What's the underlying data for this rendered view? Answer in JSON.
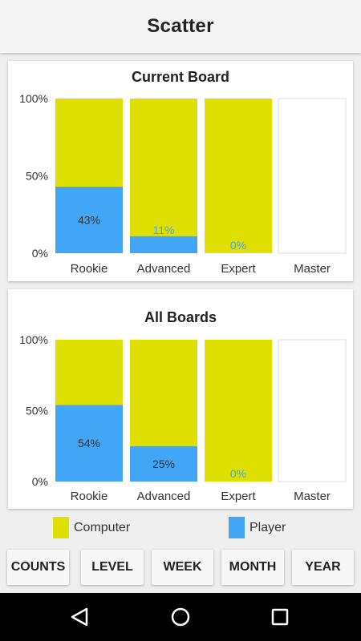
{
  "app": {
    "title": "Scatter"
  },
  "colors": {
    "computer": "#dfe000",
    "player": "#42a5f5",
    "empty": "#ffffff"
  },
  "chart_data": [
    {
      "type": "bar",
      "stacked": true,
      "title": "Current Board",
      "categories": [
        "Rookie",
        "Advanced",
        "Expert",
        "Master"
      ],
      "yticks": [
        "100%",
        "50%",
        "0%"
      ],
      "ylim": [
        0,
        100
      ],
      "series": [
        {
          "name": "Player",
          "values": [
            43,
            11,
            0,
            null
          ]
        },
        {
          "name": "Computer",
          "values": [
            57,
            89,
            100,
            null
          ]
        }
      ],
      "data_labels": [
        "43%",
        "11%",
        "0%",
        ""
      ]
    },
    {
      "type": "bar",
      "stacked": true,
      "title": "All Boards",
      "categories": [
        "Rookie",
        "Advanced",
        "Expert",
        "Master"
      ],
      "yticks": [
        "100%",
        "50%",
        "0%"
      ],
      "ylim": [
        0,
        100
      ],
      "series": [
        {
          "name": "Player",
          "values": [
            54,
            25,
            0,
            null
          ]
        },
        {
          "name": "Computer",
          "values": [
            46,
            75,
            100,
            null
          ]
        }
      ],
      "data_labels": [
        "54%",
        "25%",
        "0%",
        ""
      ]
    }
  ],
  "legend": [
    {
      "name": "Computer",
      "color": "#dfe000"
    },
    {
      "name": "Player",
      "color": "#42a5f5"
    }
  ],
  "buttons": [
    "COUNTS",
    "LEVEL",
    "WEEK",
    "MONTH",
    "YEAR"
  ],
  "navbar": {
    "icons": [
      "back-icon",
      "home-icon",
      "recents-icon"
    ]
  }
}
